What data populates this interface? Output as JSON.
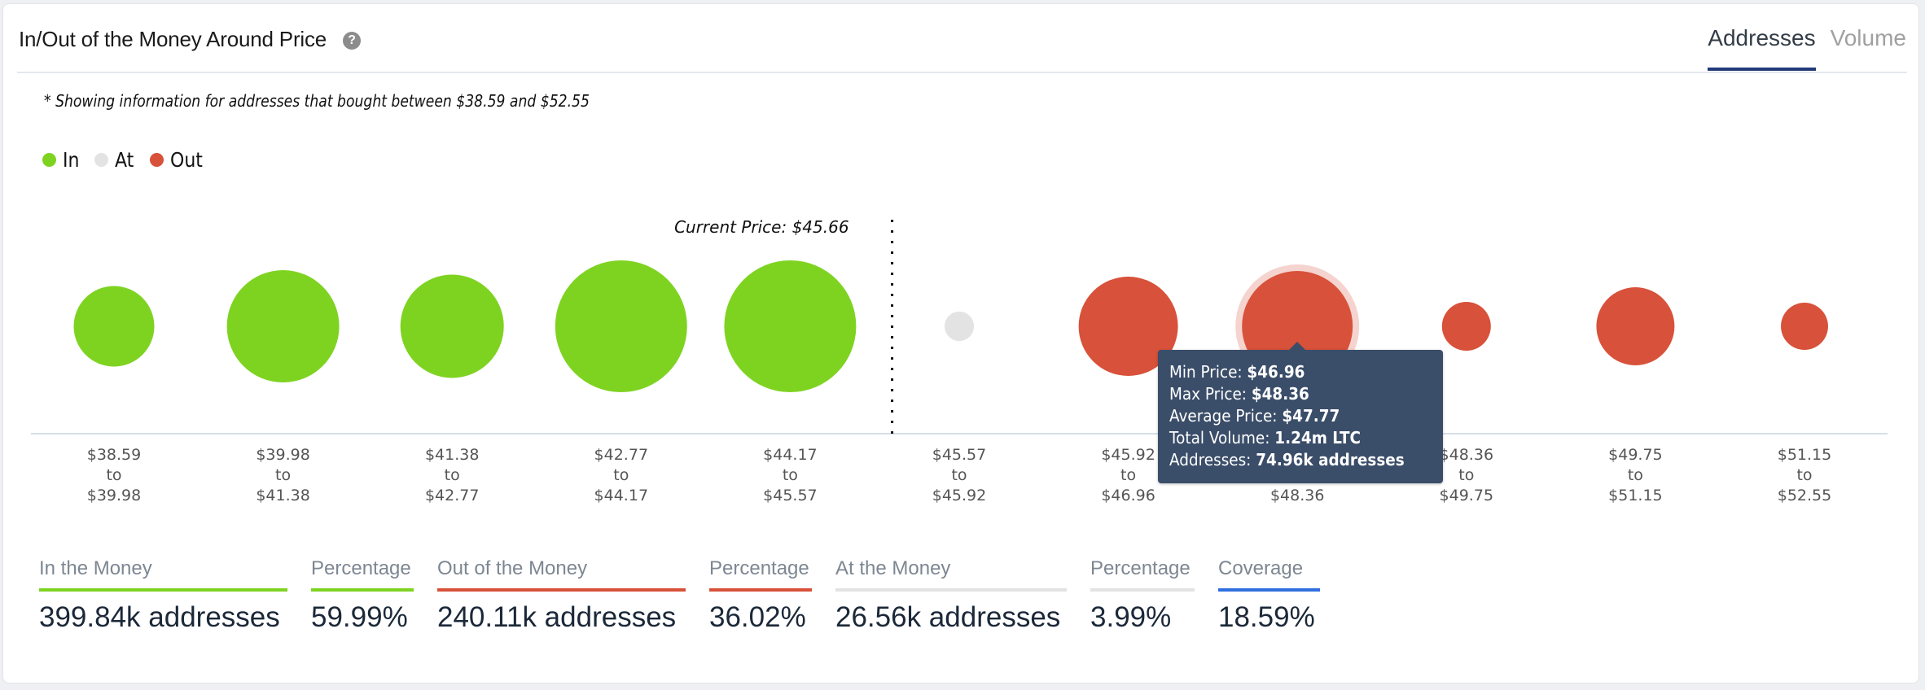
{
  "header": {
    "title": "In/Out of the Money Around Price",
    "help_icon": "question-circle-icon",
    "tabs": [
      {
        "label": "Addresses",
        "active": true
      },
      {
        "label": "Volume",
        "active": false
      }
    ]
  },
  "subtitle": "* Showing information for addresses that bought between $38.59 and $52.55",
  "colors": {
    "in": "#7ed321",
    "at": "#e3e3e3",
    "out": "#d8513a",
    "coverage": "#2f6fe0",
    "tab_active": "#213a78",
    "tooltip_bg": "#3a4d69"
  },
  "chart_data": {
    "type": "bubble",
    "title": "In/Out of the Money Around Price",
    "legend": [
      {
        "key": "in",
        "label": "In"
      },
      {
        "key": "at",
        "label": "At"
      },
      {
        "key": "out",
        "label": "Out"
      }
    ],
    "legend_position": "top-left",
    "current_price": 45.66,
    "current_price_label": "Current Price: $45.66",
    "range_connector": "to",
    "bins": [
      {
        "min": "$38.59",
        "max": "$39.98",
        "min_v": 38.59,
        "max_v": 39.98,
        "status": "in",
        "addresses_k": 39.7
      },
      {
        "min": "$39.98",
        "max": "$41.38",
        "min_v": 39.98,
        "max_v": 41.38,
        "status": "in",
        "addresses_k": 77.2
      },
      {
        "min": "$41.38",
        "max": "$42.77",
        "min_v": 41.38,
        "max_v": 42.77,
        "status": "in",
        "addresses_k": 65.4
      },
      {
        "min": "$42.77",
        "max": "$44.17",
        "min_v": 42.77,
        "max_v": 44.17,
        "status": "in",
        "addresses_k": 106.4
      },
      {
        "min": "$44.17",
        "max": "$45.57",
        "min_v": 44.17,
        "max_v": 45.57,
        "status": "in",
        "addresses_k": 106.4
      },
      {
        "min": "$45.57",
        "max": "$45.92",
        "min_v": 45.57,
        "max_v": 45.92,
        "status": "at",
        "addresses_k": 5.3
      },
      {
        "min": "$45.92",
        "max": "$46.96",
        "min_v": 45.92,
        "max_v": 46.96,
        "status": "out",
        "addresses_k": 60.3
      },
      {
        "min": "$46.96",
        "max": "$48.36",
        "min_v": 46.96,
        "max_v": 48.36,
        "status": "out",
        "addresses_k": 74.96,
        "hovered": true
      },
      {
        "min": "$48.36",
        "max": "$49.75",
        "min_v": 48.36,
        "max_v": 49.75,
        "status": "out",
        "addresses_k": 14.6
      },
      {
        "min": "$49.75",
        "max": "$51.15",
        "min_v": 49.75,
        "max_v": 51.15,
        "status": "out",
        "addresses_k": 37.3
      },
      {
        "min": "$51.15",
        "max": "$52.55",
        "min_v": 51.15,
        "max_v": 52.55,
        "status": "out",
        "addresses_k": 13.6
      }
    ]
  },
  "tooltip": {
    "lines": [
      {
        "label": "Min Price: ",
        "value": "$46.96"
      },
      {
        "label": "Max Price: ",
        "value": "$48.36"
      },
      {
        "label": "Average Price: ",
        "value": "$47.77"
      },
      {
        "label": "Total Volume: ",
        "value": "1.24m LTC"
      },
      {
        "label": "Addresses: ",
        "value": "74.96k addresses"
      }
    ]
  },
  "summary": [
    {
      "label": "In the Money",
      "value": "399.84k addresses",
      "color_key": "in"
    },
    {
      "label": "Percentage",
      "value": "59.99%",
      "color_key": "in"
    },
    {
      "label": "Out of the Money",
      "value": "240.11k addresses",
      "color_key": "out"
    },
    {
      "label": "Percentage",
      "value": "36.02%",
      "color_key": "out"
    },
    {
      "label": "At the Money",
      "value": "26.56k addresses",
      "color_key": "at"
    },
    {
      "label": "Percentage",
      "value": "3.99%",
      "color_key": "at"
    },
    {
      "label": "Coverage",
      "value": "18.59%",
      "color_key": "coverage"
    }
  ]
}
